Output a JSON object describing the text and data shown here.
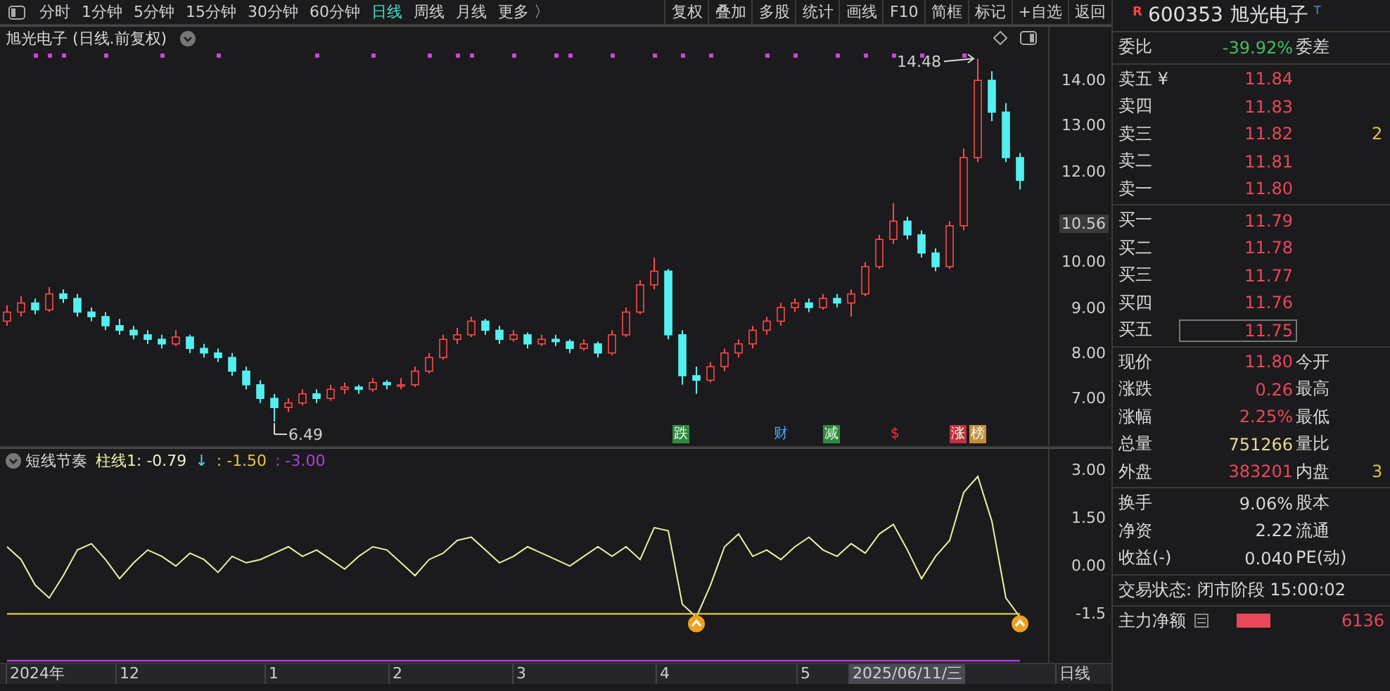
{
  "toolbar": {
    "periods": [
      {
        "label": "分时",
        "selected": false
      },
      {
        "label": "1分钟",
        "selected": false
      },
      {
        "label": "5分钟",
        "selected": false
      },
      {
        "label": "15分钟",
        "selected": false
      },
      {
        "label": "30分钟",
        "selected": false
      },
      {
        "label": "60分钟",
        "selected": false
      },
      {
        "label": "日线",
        "selected": true
      },
      {
        "label": "周线",
        "selected": false
      },
      {
        "label": "月线",
        "selected": false
      },
      {
        "label": "更多 〉",
        "selected": false
      }
    ],
    "buttons": [
      "复权",
      "叠加",
      "多股",
      "统计",
      "画线",
      "F10",
      "简框",
      "标记",
      "+自选",
      "返回"
    ]
  },
  "main_chart": {
    "title": "旭光电子 (日线.前复权)",
    "current_price": "10.56",
    "chart_data": {
      "type": "candlestick",
      "ylim": [
        5.95,
        15.18
      ],
      "yticks": [
        {
          "value": 14,
          "label": "14.00"
        },
        {
          "value": 13,
          "label": "13.00"
        },
        {
          "value": 12,
          "label": "12.00"
        },
        {
          "value": 10,
          "label": "10.00"
        },
        {
          "value": 9,
          "label": "9.00"
        },
        {
          "value": 8,
          "label": "8.00"
        },
        {
          "value": 7,
          "label": "7.00"
        }
      ],
      "annotations": [
        "14.48",
        "6.49"
      ],
      "ohlc": [
        [
          8.7,
          9.05,
          8.6,
          8.9
        ],
        [
          8.9,
          9.25,
          8.8,
          9.1
        ],
        [
          9.1,
          9.2,
          8.85,
          8.95
        ],
        [
          8.95,
          9.45,
          8.9,
          9.3
        ],
        [
          9.3,
          9.4,
          9.1,
          9.2
        ],
        [
          9.2,
          9.3,
          8.8,
          8.9
        ],
        [
          8.9,
          9.0,
          8.7,
          8.8
        ],
        [
          8.8,
          8.9,
          8.5,
          8.6
        ],
        [
          8.6,
          8.75,
          8.4,
          8.5
        ],
        [
          8.5,
          8.6,
          8.3,
          8.4
        ],
        [
          8.4,
          8.5,
          8.2,
          8.3
        ],
        [
          8.3,
          8.4,
          8.1,
          8.2
        ],
        [
          8.2,
          8.5,
          8.15,
          8.35
        ],
        [
          8.35,
          8.4,
          8.0,
          8.1
        ],
        [
          8.1,
          8.2,
          7.9,
          8.0
        ],
        [
          8.0,
          8.1,
          7.8,
          7.9
        ],
        [
          7.9,
          8.0,
          7.5,
          7.6
        ],
        [
          7.6,
          7.7,
          7.2,
          7.3
        ],
        [
          7.3,
          7.4,
          6.9,
          7.0
        ],
        [
          7.0,
          7.1,
          6.49,
          6.8
        ],
        [
          6.8,
          7.0,
          6.7,
          6.9
        ],
        [
          6.9,
          7.2,
          6.85,
          7.1
        ],
        [
          7.1,
          7.2,
          6.9,
          7.0
        ],
        [
          7.0,
          7.3,
          6.95,
          7.2
        ],
        [
          7.2,
          7.35,
          7.1,
          7.25
        ],
        [
          7.25,
          7.3,
          7.1,
          7.2
        ],
        [
          7.2,
          7.45,
          7.15,
          7.35
        ],
        [
          7.35,
          7.4,
          7.2,
          7.3
        ],
        [
          7.3,
          7.45,
          7.2,
          7.3
        ],
        [
          7.3,
          7.7,
          7.25,
          7.6
        ],
        [
          7.6,
          8.0,
          7.55,
          7.9
        ],
        [
          7.9,
          8.4,
          7.85,
          8.3
        ],
        [
          8.3,
          8.55,
          8.2,
          8.4
        ],
        [
          8.4,
          8.8,
          8.35,
          8.7
        ],
        [
          8.7,
          8.75,
          8.4,
          8.5
        ],
        [
          8.5,
          8.6,
          8.2,
          8.3
        ],
        [
          8.3,
          8.5,
          8.25,
          8.4
        ],
        [
          8.4,
          8.45,
          8.1,
          8.2
        ],
        [
          8.2,
          8.4,
          8.15,
          8.3
        ],
        [
          8.3,
          8.4,
          8.15,
          8.25
        ],
        [
          8.25,
          8.3,
          8.0,
          8.1
        ],
        [
          8.1,
          8.3,
          8.05,
          8.2
        ],
        [
          8.2,
          8.25,
          7.9,
          8.0
        ],
        [
          8.0,
          8.5,
          7.95,
          8.4
        ],
        [
          8.4,
          9.0,
          8.35,
          8.9
        ],
        [
          8.9,
          9.6,
          8.85,
          9.5
        ],
        [
          9.5,
          10.1,
          9.4,
          9.8
        ],
        [
          9.8,
          9.85,
          8.3,
          8.4
        ],
        [
          8.4,
          8.5,
          7.3,
          7.5
        ],
        [
          7.5,
          7.7,
          7.1,
          7.4
        ],
        [
          7.4,
          7.8,
          7.35,
          7.7
        ],
        [
          7.7,
          8.1,
          7.6,
          8.0
        ],
        [
          8.0,
          8.3,
          7.9,
          8.2
        ],
        [
          8.2,
          8.6,
          8.1,
          8.5
        ],
        [
          8.5,
          8.8,
          8.4,
          8.7
        ],
        [
          8.7,
          9.1,
          8.6,
          9.0
        ],
        [
          9.0,
          9.2,
          8.9,
          9.1
        ],
        [
          9.1,
          9.2,
          8.9,
          9.0
        ],
        [
          9.0,
          9.3,
          8.95,
          9.2
        ],
        [
          9.2,
          9.3,
          9.0,
          9.1
        ],
        [
          9.1,
          9.4,
          8.8,
          9.3
        ],
        [
          9.3,
          10.0,
          9.25,
          9.9
        ],
        [
          9.9,
          10.6,
          9.85,
          10.5
        ],
        [
          10.5,
          11.3,
          10.4,
          10.9
        ],
        [
          10.9,
          11.0,
          10.5,
          10.6
        ],
        [
          10.6,
          10.7,
          10.1,
          10.2
        ],
        [
          10.2,
          10.3,
          9.8,
          9.9
        ],
        [
          9.9,
          10.9,
          9.85,
          10.8
        ],
        [
          10.8,
          12.5,
          10.7,
          12.3
        ],
        [
          12.3,
          14.48,
          12.2,
          14.0
        ],
        [
          14.0,
          14.2,
          13.1,
          13.3
        ],
        [
          13.3,
          13.5,
          12.2,
          12.3
        ],
        [
          12.3,
          12.4,
          11.6,
          11.8
        ]
      ]
    },
    "events": [
      {
        "label": "跌",
        "kind": "filled",
        "color": "#2e8b3e"
      },
      {
        "label": "财",
        "kind": "text",
        "color": "#4aa8ff"
      },
      {
        "label": "减",
        "kind": "filled",
        "color": "#2e8b3e"
      },
      {
        "label": "$",
        "kind": "text",
        "color": "#ff3030"
      },
      {
        "label": "涨",
        "kind": "filled",
        "color": "#c03040"
      },
      {
        "label": "榜",
        "kind": "filled",
        "color": "#c88a40"
      }
    ]
  },
  "indicator": {
    "name": "短线节奏",
    "legend": [
      {
        "label": ": -0.79",
        "color": "#f0f0c8"
      },
      {
        "label": "↓",
        "color": "#54d8ff"
      },
      {
        "label": ": -1.50",
        "color": "#e0c840"
      },
      {
        "label": ": -3.00",
        "color": "#b040e0"
      }
    ],
    "chart_data": {
      "type": "line",
      "ylim": [
        -3.03,
        3.66
      ],
      "yticks": [
        {
          "value": 3,
          "label": "3.00"
        },
        {
          "value": 1.5,
          "label": "1.50"
        },
        {
          "value": 0,
          "label": "0.00"
        },
        {
          "value": -1.5,
          "label": "-1.5"
        }
      ],
      "series": [
        {
          "name": "柱线1",
          "color": "#f0f0a0",
          "values": [
            0.6,
            0.2,
            -0.6,
            -1.0,
            -0.3,
            0.5,
            0.7,
            0.2,
            -0.4,
            0.1,
            0.5,
            0.3,
            0.0,
            0.4,
            0.2,
            -0.2,
            0.3,
            0.1,
            0.2,
            0.4,
            0.6,
            0.3,
            0.5,
            0.2,
            -0.1,
            0.3,
            0.6,
            0.5,
            0.1,
            -0.3,
            0.2,
            0.4,
            0.8,
            0.9,
            0.5,
            0.1,
            0.3,
            0.6,
            0.4,
            0.2,
            0.0,
            0.3,
            0.6,
            0.3,
            0.6,
            0.2,
            1.2,
            1.1,
            -1.2,
            -1.6,
            -0.6,
            0.6,
            1.0,
            0.3,
            0.5,
            0.2,
            0.6,
            0.9,
            0.5,
            0.3,
            0.7,
            0.4,
            1.0,
            1.3,
            0.5,
            -0.4,
            0.3,
            0.8,
            2.3,
            2.8,
            1.4,
            -1.0,
            -1.6
          ]
        },
        {
          "color": "#e0c840",
          "values": [
            -1.5,
            -1.5,
            -1.5,
            -1.5,
            -1.5,
            -1.5,
            -1.5,
            -1.5,
            -1.5,
            -1.5,
            -1.5,
            -1.5,
            -1.5,
            -1.5,
            -1.5,
            -1.5,
            -1.5,
            -1.5,
            -1.5,
            -1.5,
            -1.5,
            -1.5,
            -1.5,
            -1.5,
            -1.5,
            -1.5,
            -1.5,
            -1.5,
            -1.5,
            -1.5,
            -1.5,
            -1.5,
            -1.5,
            -1.5,
            -1.5,
            -1.5,
            -1.5,
            -1.5,
            -1.5,
            -1.5,
            -1.5,
            -1.5,
            -1.5,
            -1.5,
            -1.5,
            -1.5,
            -1.5,
            -1.5,
            -1.5,
            -1.5,
            -1.5,
            -1.5,
            -1.5,
            -1.5,
            -1.5,
            -1.5,
            -1.5,
            -1.5,
            -1.5,
            -1.5,
            -1.5,
            -1.5,
            -1.5,
            -1.5,
            -1.5,
            -1.5,
            -1.5,
            -1.5,
            -1.5,
            -1.5,
            -1.5,
            -1.5,
            -1.5
          ]
        },
        {
          "color": "#b040e0",
          "values": [
            -3.0,
            -3.0,
            -3.0,
            -3.0,
            -3.0,
            -3.0,
            -3.0,
            -3.0,
            -3.0,
            -3.0,
            -3.0,
            -3.0,
            -3.0,
            -3.0,
            -3.0,
            -3.0,
            -3.0,
            -3.0,
            -3.0,
            -3.0,
            -3.0,
            -3.0,
            -3.0,
            -3.0,
            -3.0,
            -3.0,
            -3.0,
            -3.0,
            -3.0,
            -3.0,
            -3.0,
            -3.0,
            -3.0,
            -3.0,
            -3.0,
            -3.0,
            -3.0,
            -3.0,
            -3.0,
            -3.0,
            -3.0,
            -3.0,
            -3.0,
            -3.0,
            -3.0,
            -3.0,
            -3.0,
            -3.0,
            -3.0,
            -3.0,
            -3.0,
            -3.0,
            -3.0,
            -3.0,
            -3.0,
            -3.0,
            -3.0,
            -3.0,
            -3.0,
            -3.0,
            -3.0,
            -3.0,
            -3.0,
            -3.0,
            -3.0,
            -3.0,
            -3.0,
            -3.0,
            -3.0,
            -3.0,
            -3.0,
            -3.0,
            -3.0
          ]
        }
      ]
    }
  },
  "time_axis": {
    "labels": [
      {
        "label": "2024年",
        "kind": "tick"
      },
      {
        "label": "12",
        "kind": "tick"
      },
      {
        "label": "1",
        "kind": "tick"
      },
      {
        "label": "2",
        "kind": "tick"
      },
      {
        "label": "3",
        "kind": "tick"
      },
      {
        "label": "4",
        "kind": "tick"
      },
      {
        "label": "5",
        "kind": "tick"
      },
      {
        "label": "2025/06/11/三",
        "kind": "cursor"
      }
    ],
    "period": "日线"
  },
  "quote_panel": {
    "badge": "R",
    "code": "600353",
    "name": "旭光电子",
    "flag": "T",
    "ratio": {
      "label": "委比",
      "value": "-39.92%",
      "label2": "委差"
    },
    "asks": [
      {
        "label": "卖五 ¥",
        "price": "11.84",
        "selected": false
      },
      {
        "label": "卖四",
        "price": "11.83",
        "selected": false
      },
      {
        "label": "卖三",
        "price": "11.82",
        "selected": false,
        "extra": "2"
      },
      {
        "label": "卖二",
        "price": "11.81",
        "selected": false
      },
      {
        "label": "卖一",
        "price": "11.80",
        "selected": false
      }
    ],
    "bids": [
      {
        "label": "买一",
        "price": "11.79",
        "selected": false
      },
      {
        "label": "买二",
        "price": "11.78",
        "selected": false
      },
      {
        "label": "买三",
        "price": "11.77",
        "selected": false
      },
      {
        "label": "买四",
        "price": "11.76",
        "selected": false
      },
      {
        "label": "买五",
        "price": "11.75",
        "selected": true
      }
    ],
    "stats": [
      {
        "label": "现价",
        "value": "11.80",
        "color": "#e84858",
        "label2": "今开"
      },
      {
        "label": "涨跌",
        "value": "0.26",
        "color": "#e84858",
        "label2": "最高"
      },
      {
        "label": "涨幅",
        "value": "2.25%",
        "color": "#e84858",
        "label2": "最低"
      },
      {
        "label": "总量",
        "value": "751266",
        "color": "#e8d890",
        "label2": "量比"
      },
      {
        "label": "外盘",
        "value": "383201",
        "color": "#e84858",
        "label2": "内盘",
        "extra": "3"
      }
    ],
    "stats2": [
      {
        "label": "换手",
        "value": "9.06%",
        "label2": "股本"
      },
      {
        "label": "净资",
        "value": "2.22",
        "label2": "流通"
      },
      {
        "label": "收益(-)",
        "value": "0.040",
        "label2": "PE(动)"
      }
    ],
    "status": "交易状态: 闭市阶段 15:00:02",
    "flow_label": "主力净额",
    "flow_value": "6136"
  }
}
